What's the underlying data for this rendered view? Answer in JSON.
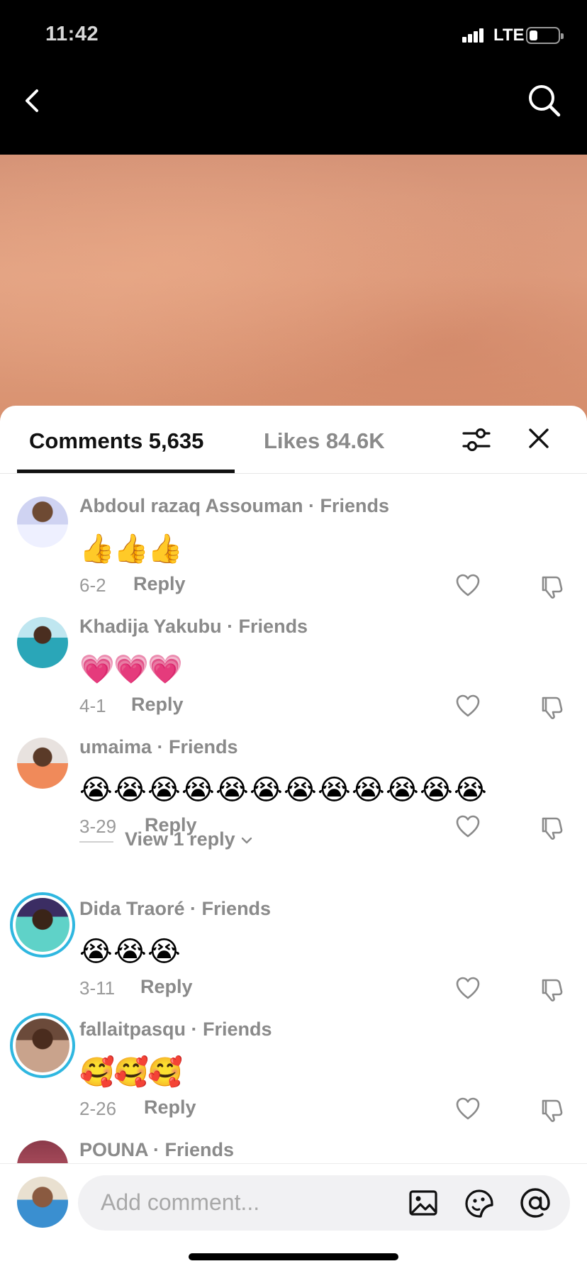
{
  "status_bar": {
    "time": "11:42",
    "network": "LTE"
  },
  "tabs": {
    "comments_label": "Comments 5,635",
    "likes_label": "Likes 84.6K"
  },
  "comments": [
    {
      "author": "Abdoul razaq Assouman · Friends",
      "emoji": [
        "👍",
        "👍",
        "👍"
      ],
      "date": "6-2",
      "reply": "Reply"
    },
    {
      "author": "Khadija Yakubu · Friends",
      "emoji": [
        "💗",
        "💗",
        "💗"
      ],
      "date": "4-1",
      "reply": "Reply"
    },
    {
      "author": "umaima · Friends",
      "emoji": [
        "😭",
        "😭",
        "😭",
        "😭",
        "😭",
        "😭",
        "😭",
        "😭",
        "😭",
        "😭",
        "😭",
        "😭"
      ],
      "date": "3-29",
      "reply": "Reply"
    },
    {
      "author": "Dida Traoré · Friends",
      "emoji": [
        "😭",
        "😭",
        "😭"
      ],
      "date": "3-11",
      "reply": "Reply"
    },
    {
      "author": "fallaitpasqu · Friends",
      "emoji": [
        "🥰",
        "🥰",
        "🥰"
      ],
      "date": "2-26",
      "reply": "Reply"
    },
    {
      "author": "POUNA · Friends"
    }
  ],
  "view_replies": "View 1 reply",
  "composer": {
    "placeholder": "Add comment..."
  },
  "icons": [
    "back-icon",
    "search-icon",
    "filter-icon",
    "close-icon",
    "heart-icon",
    "dislike-icon",
    "image-icon",
    "sticker-icon",
    "at-icon"
  ],
  "colors": {
    "accent_ring": "#2fb7e0",
    "video_bg": "#d8916f"
  }
}
